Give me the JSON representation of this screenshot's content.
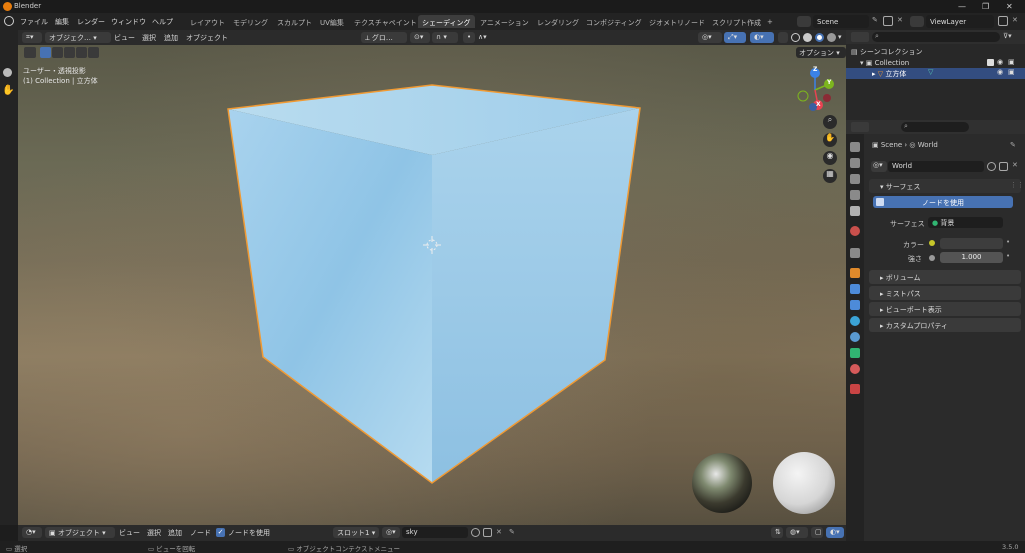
{
  "window": {
    "title": "Blender"
  },
  "menu": [
    "ファイル",
    "編集",
    "レンダー",
    "ウィンドウ",
    "ヘルプ"
  ],
  "workspaces": [
    "レイアウト",
    "モデリング",
    "スカルプト",
    "UV編集",
    "テクスチャペイント",
    "シェーディング",
    "アニメーション",
    "レンダリング",
    "コンポジティング",
    "ジオメトリノード",
    "スクリプト作成"
  ],
  "active_workspace_index": 5,
  "scene": {
    "name": "Scene",
    "view_layer": "ViewLayer"
  },
  "viewport_header": {
    "mode": "オブジェク…",
    "menus": [
      "ビュー",
      "選択",
      "追加",
      "オブジェクト"
    ],
    "transform": "グロ…",
    "options": "オプション"
  },
  "viewport": {
    "view_label": "ユーザー・透視投影",
    "context_label": "(1) Collection | 立方体",
    "gizmo": {
      "x": "X",
      "y": "Y",
      "z": "Z"
    },
    "colors": {
      "accent_orange": "#f09a34",
      "cube_blue": "#8fc4e6",
      "gizmo_x": "#e84352",
      "gizmo_y": "#7db51e",
      "gizmo_z": "#3b82e6"
    }
  },
  "viewport_footer": {
    "mode": "オブジェクト",
    "menus": [
      "ビュー",
      "選択",
      "追加",
      "ノード"
    ],
    "use_nodes_label": "ノードを使用",
    "use_nodes_checked": true,
    "slot": "スロット1",
    "world_name": "sky"
  },
  "outliner": {
    "root": "シーンコレクション",
    "collection": "Collection",
    "object": "立方体"
  },
  "properties": {
    "breadcrumb": [
      "Scene",
      "World"
    ],
    "world_name": "World",
    "sections": {
      "surface": "サーフェス",
      "use_nodes_button": "ノードを使用",
      "surface_label": "サーフェス",
      "surface_value": "背景",
      "color_label": "カラー",
      "strength_label": "強さ",
      "strength_value": "1.000",
      "volume": "ボリューム",
      "mist": "ミストパス",
      "viewport_display": "ビューポート表示",
      "custom_props": "カスタムプロパティ"
    }
  },
  "statusbar": {
    "left": "選択",
    "middle": "ビューを回転",
    "right": "オブジェクトコンテクストメニュー",
    "version": "3.5.0"
  }
}
